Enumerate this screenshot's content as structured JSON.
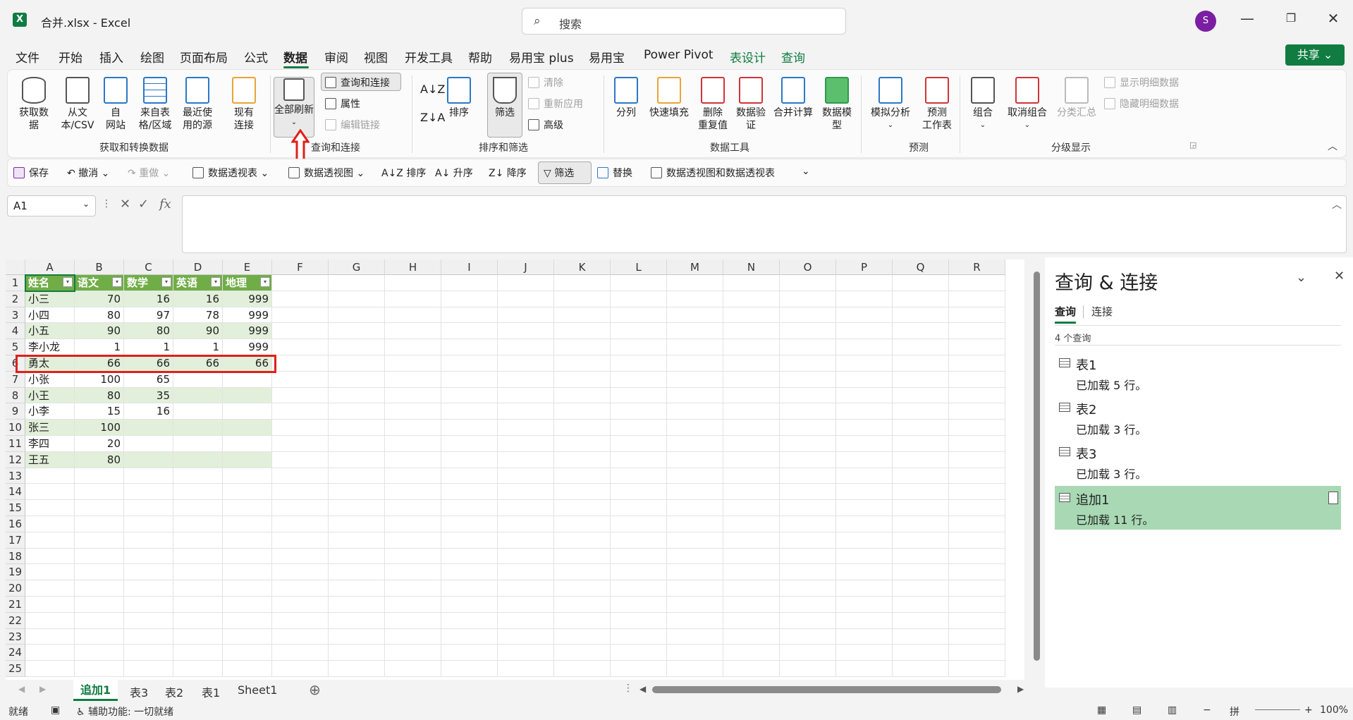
{
  "titlebar": {
    "logo": "X",
    "title": "合并.xlsx  -  Excel",
    "search_placeholder": "搜索",
    "avatar_letter": "S",
    "min": "—",
    "restore": "❐",
    "close": "✕"
  },
  "menu": {
    "tabs": [
      "文件",
      "开始",
      "插入",
      "绘图",
      "页面布局",
      "公式",
      "数据",
      "审阅",
      "视图",
      "开发工具",
      "帮助",
      "易用宝 plus",
      "易用宝",
      "Power Pivot",
      "表设计",
      "查询"
    ],
    "active": "数据",
    "share": "共享"
  },
  "ribbon": {
    "get_data": "获取数\n据",
    "from_csv": "从文\n本/CSV",
    "from_web": "自\n网站",
    "from_table": "来自表\n格/区域",
    "recent_sources": "最近使\n用的源",
    "existing_conn": "现有\n连接",
    "group_get": "获取和转换数据",
    "refresh_all": "全部刷新",
    "queries_conn": "查询和连接",
    "properties": "属性",
    "edit_links": "编辑链接",
    "group_queries": "查询和连接",
    "sort_btn": "排序",
    "filter_btn": "筛选",
    "clear": "清除",
    "reapply": "重新应用",
    "advanced": "高级",
    "group_sort": "排序和筛选",
    "text_to_cols": "分列",
    "flash_fill": "快速填充",
    "remove_dups": "删除\n重复值",
    "data_valid": "数据验\n证",
    "consolidate": "合并计算",
    "data_model": "数据模\n型",
    "group_tools": "数据工具",
    "what_if": "模拟分析",
    "forecast": "预测\n工作表",
    "group_forecast": "预测",
    "group_btn": "组合",
    "ungroup": "取消组合",
    "subtotal": "分类汇总",
    "show_detail": "显示明细数据",
    "hide_detail": "隐藏明细数据",
    "group_outline": "分级显示"
  },
  "qat": {
    "save": "保存",
    "undo": "撤消",
    "redo": "重做",
    "pivot_table": "数据透视表",
    "pivot_chart": "数据透视图",
    "sort": "排序",
    "asc": "升序",
    "desc": "降序",
    "filter": "筛选",
    "replace": "替换",
    "pivot_both": "数据透视图和数据透视表"
  },
  "formula_bar": {
    "name_box": "A1",
    "fx": "fx",
    "cancel": "✕",
    "enter": "✓",
    "value": ""
  },
  "sheet": {
    "columns": [
      "A",
      "B",
      "C",
      "D",
      "E",
      "F",
      "G",
      "H",
      "I",
      "J",
      "K",
      "L",
      "M",
      "N",
      "O",
      "P",
      "Q",
      "R"
    ],
    "rows": [
      "1",
      "2",
      "3",
      "4",
      "5",
      "6",
      "7",
      "8",
      "9",
      "10",
      "11",
      "12",
      "13",
      "14",
      "15",
      "16",
      "17",
      "18",
      "19",
      "20",
      "21",
      "22",
      "23",
      "24",
      "25"
    ],
    "table_headers": [
      "姓名",
      "语文",
      "数学",
      "英语",
      "地理"
    ],
    "table_rows": [
      [
        "小三",
        "70",
        "16",
        "16",
        "999"
      ],
      [
        "小四",
        "80",
        "97",
        "78",
        "999"
      ],
      [
        "小五",
        "90",
        "80",
        "90",
        "999"
      ],
      [
        "李小龙",
        "1",
        "1",
        "1",
        "999"
      ],
      [
        "勇太",
        "66",
        "66",
        "66",
        "66"
      ],
      [
        "小张",
        "100",
        "65",
        "",
        ""
      ],
      [
        "小王",
        "80",
        "35",
        "",
        ""
      ],
      [
        "小李",
        "15",
        "16",
        "",
        ""
      ],
      [
        "张三",
        "100",
        "",
        "",
        ""
      ],
      [
        "李四",
        "20",
        "",
        "",
        ""
      ],
      [
        "王五",
        "80",
        "",
        "",
        ""
      ]
    ]
  },
  "sheet_tabs": [
    "追加1",
    "表3",
    "表2",
    "表1",
    "Sheet1"
  ],
  "active_sheet": "追加1",
  "pane": {
    "title": "查询 & 连接",
    "tab_queries": "查询",
    "tab_conn": "连接",
    "count": "4 个查询",
    "items": [
      {
        "name": "表1",
        "desc": "已加载 5 行。"
      },
      {
        "name": "表2",
        "desc": "已加载 3 行。"
      },
      {
        "name": "表3",
        "desc": "已加载 3 行。"
      },
      {
        "name": "追加1",
        "desc": "已加载 11 行。"
      }
    ]
  },
  "status": {
    "ready": "就绪",
    "accessibility": "辅助功能: 一切就绪",
    "zoom": "100%"
  },
  "colors": {
    "accent": "#107c41",
    "table_header": "#70ad47",
    "band": "#e2efda",
    "highlight": "#e0201a"
  }
}
